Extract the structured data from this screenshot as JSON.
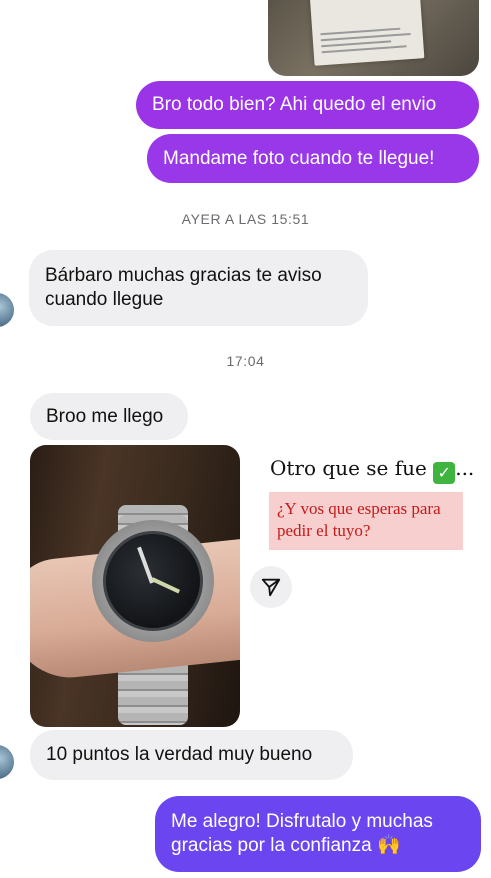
{
  "messages": {
    "out1": "Bro todo bien? Ahi quedo el envio",
    "out2": "Mandame foto cuando te llegue!",
    "in1_line1": "Bárbaro muchas gracias te aviso",
    "in1_line2": "cuando llegue",
    "in2": "Broo me llego",
    "in3": "10 puntos la verdad muy bueno",
    "out3_line1": "Me alegro! Disfrutalo y muchas",
    "out3_line2": "gracias por la confianza 🙌"
  },
  "timestamps": {
    "first": "AYER A LAS 15:51",
    "second": "17:04"
  },
  "story": {
    "headline": "Otro que se fue",
    "check_glyph": "✓",
    "ellipsis": "...",
    "promo_line1": "¿Y vos que esperas para",
    "promo_line2": "pedir el tuyo?"
  },
  "colors": {
    "outgoing_top": "#9b34e6",
    "outgoing_bottom": "#6a45f0",
    "incoming": "#efeff1",
    "promo_bg": "#f7cfcf",
    "promo_text": "#c51a1a"
  },
  "icons": {
    "share": "paper-plane-icon"
  }
}
